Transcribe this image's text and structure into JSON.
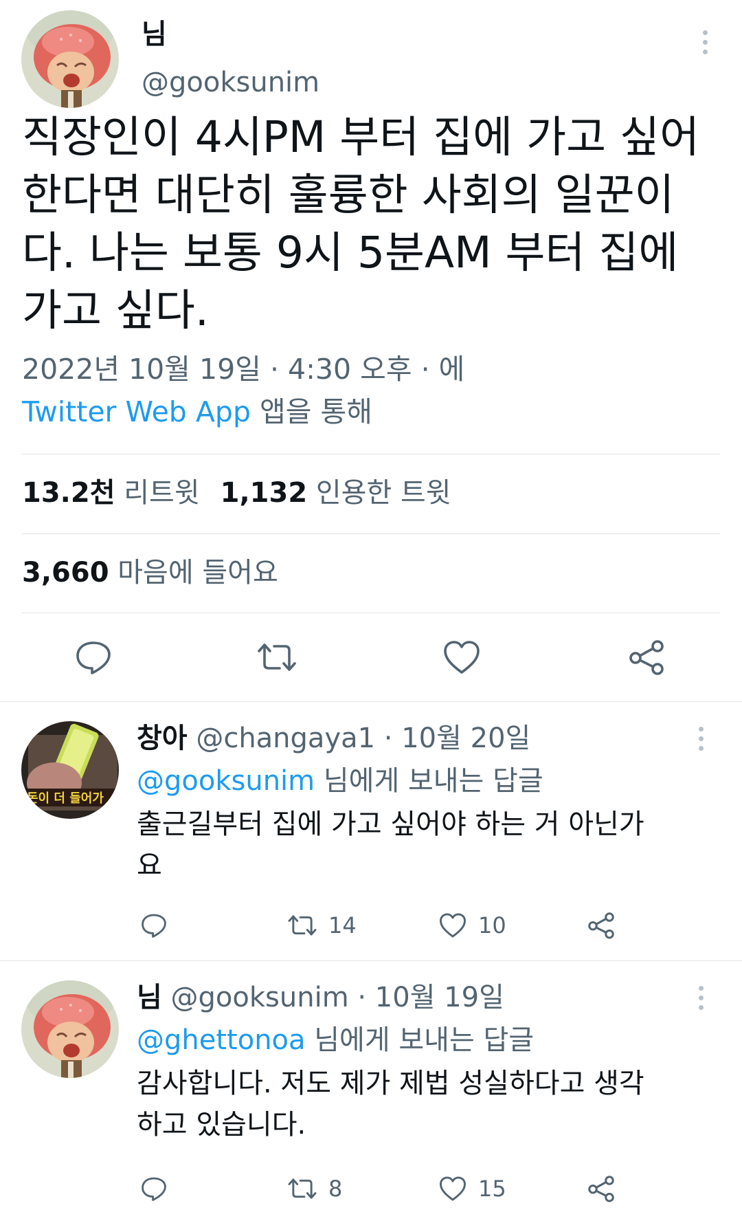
{
  "main_tweet": {
    "author_name": "님",
    "author_handle": "@gooksunim",
    "text_lines": [
      "직장인이 4시PM 부터 집에 가고 싶어",
      "한다면 대단히 훌륭한 사회의 일꾼이",
      "다. 나는 보통 9시 5분AM 부터 집에",
      "가고 싶다."
    ],
    "timestamp": "2022년 10월 19일 · 4:30 오후 · 에",
    "source_app": "Twitter Web App",
    "source_suffix": " 앱을 통해",
    "retweets_count": "13.2천",
    "retweets_label": " 리트윗",
    "quotes_count": "1,132",
    "quotes_label": " 인용한 트윗",
    "likes_count": "3,660",
    "likes_label": " 마음에 들어요"
  },
  "replies": [
    {
      "author_name": "창아",
      "author_handle": "@changaya1",
      "date": " · 10월 20일",
      "reply_to_mention": "@gooksunim",
      "reply_to_suffix": " 님에게 보내는 답글",
      "text_lines": [
        "출근길부터 집에 가고 싶어야 하는 거 아닌가",
        "요"
      ],
      "retweets": "14",
      "likes": "10",
      "avatar_caption": "돈이 더 들어가"
    },
    {
      "author_name": "님",
      "author_handle": "@gooksunim",
      "date": " · 10월 19일",
      "reply_to_mention": "@ghettonoa",
      "reply_to_suffix": " 님에게 보내는 답글",
      "text_lines": [
        "감사합니다. 저도 제가 제법 성실하다고 생각",
        "하고 있습니다."
      ],
      "retweets": "8",
      "likes": "15"
    }
  ],
  "colors": {
    "link": "#1d9bf0",
    "secondary_text": "#536471",
    "primary_text": "#0f1419",
    "divider": "#dfe3e7",
    "icon": "#536471"
  },
  "icons": {
    "more": "more-vertical-icon",
    "reply": "reply-icon",
    "retweet": "retweet-icon",
    "like": "heart-icon",
    "share": "share-icon"
  }
}
